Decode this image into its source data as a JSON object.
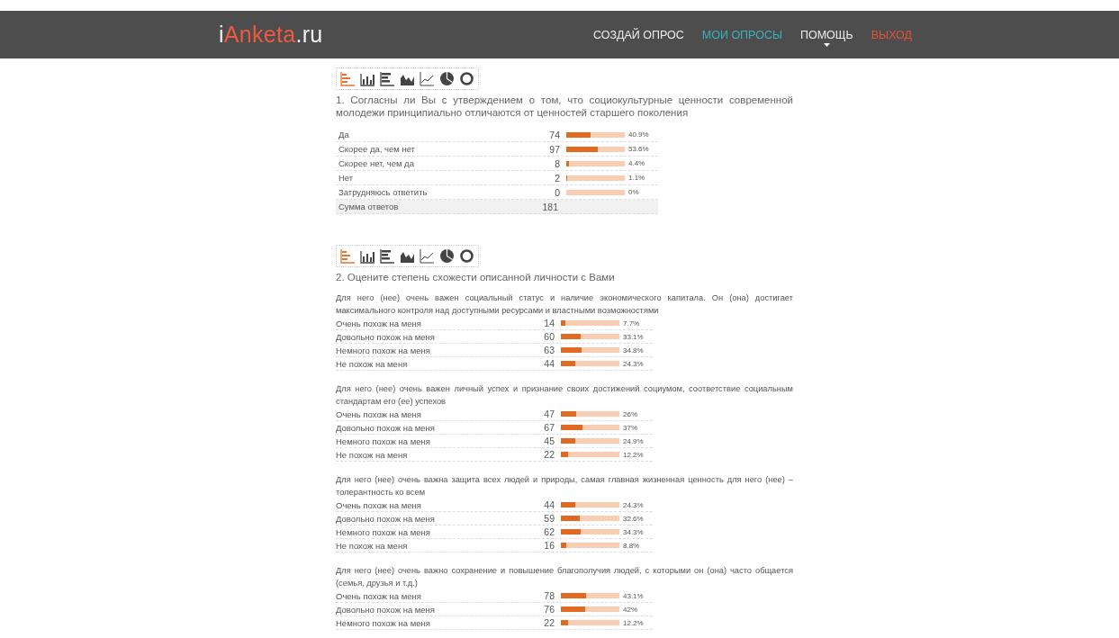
{
  "header": {
    "logo": [
      {
        "text": "i",
        "accent": false
      },
      {
        "text": "Anketa",
        "accent": true
      },
      {
        "text": ".ru",
        "accent": false
      }
    ],
    "nav": [
      {
        "label": "СОЗДАЙ ОПРОС",
        "kind": "link",
        "selected": false,
        "has_menu": false
      },
      {
        "label": "МОИ ОПРОСЫ",
        "kind": "link",
        "selected": true,
        "has_menu": false
      },
      {
        "label": "ПОМОЩЬ",
        "kind": "link",
        "selected": false,
        "has_menu": true
      },
      {
        "label": "ВЫХОД",
        "kind": "logout",
        "selected": false,
        "has_menu": false
      }
    ]
  },
  "questions": [
    {
      "chart_types": [
        {
          "kind": "hbar",
          "selected": true
        },
        {
          "kind": "vbar",
          "selected": false
        },
        {
          "kind": "hbar2",
          "selected": false
        },
        {
          "kind": "area",
          "selected": false
        },
        {
          "kind": "line",
          "selected": false
        },
        {
          "kind": "pie",
          "selected": false
        },
        {
          "kind": "donut",
          "selected": false
        }
      ],
      "title": "1. Согласны ли Вы с утверждением о том, что социокультурные ценности современной молодежи принципиально отличаются от ценностей старшего поколения",
      "tables": [
        {
          "rows": [
            {
              "label": "Да",
              "count": "74",
              "level": 0.409,
              "percent": "40.9%"
            },
            {
              "label": "Скорее да, чем нет",
              "count": "97",
              "level": 0.536,
              "percent": "53.6%"
            },
            {
              "label": "Скорее нет, чем да",
              "count": "8",
              "level": 0.044,
              "percent": "4.4%"
            },
            {
              "label": "Нет",
              "count": "2",
              "level": 0.011,
              "percent": "1.1%"
            },
            {
              "label": "Затрудняюсь ответить",
              "count": "0",
              "percent": "0%"
            }
          ],
          "total": {
            "label": "Сумма ответов",
            "count": "181"
          }
        }
      ]
    },
    {
      "chart_types": [
        {
          "kind": "hbar",
          "selected": true
        },
        {
          "kind": "vbar",
          "selected": false
        },
        {
          "kind": "hbar2",
          "selected": false
        },
        {
          "kind": "area",
          "selected": false
        },
        {
          "kind": "line",
          "selected": false
        },
        {
          "kind": "pie",
          "selected": false
        },
        {
          "kind": "donut",
          "selected": false
        }
      ],
      "title": "2. Оцените степень схожести описанной личности с Вами",
      "tables": [
        {
          "description": "Для него (нее) очень важен социальный статус и наличие экономического капитала. Он (она) достигает максимального контроля над доступными ресурсами и властными возможностями",
          "rows": [
            {
              "label": "Очень похож на меня",
              "count": "14",
              "level": 0.077,
              "percent": "7.7%"
            },
            {
              "label": "Довольно похож на меня",
              "count": "60",
              "level": 0.331,
              "percent": "33.1%"
            },
            {
              "label": "Немного похож на меня",
              "count": "63",
              "level": 0.348,
              "percent": "34.8%"
            },
            {
              "label": "Не похож на меня",
              "count": "44",
              "level": 0.243,
              "percent": "24.3%"
            }
          ]
        },
        {
          "description": "Для него (нее) очень важен личный успех и признание своих достижений социумом, соответствие социальным стандартам его (ее) успехов",
          "rows": [
            {
              "label": "Очень похож на меня",
              "count": "47",
              "level": 0.26,
              "percent": "26%"
            },
            {
              "label": "Довольно похож на меня",
              "count": "67",
              "level": 0.37,
              "percent": "37%"
            },
            {
              "label": "Немного похож на меня",
              "count": "45",
              "level": 0.249,
              "percent": "24.9%"
            },
            {
              "label": "Не похож на меня",
              "count": "22",
              "level": 0.122,
              "percent": "12.2%"
            }
          ]
        },
        {
          "description": "Для него (нее) очень важна защита всех людей и природы, самая главная жизненная ценность для него (нее) – толерантность ко всем",
          "rows": [
            {
              "label": "Очень похож на меня",
              "count": "44",
              "level": 0.243,
              "percent": "24.3%"
            },
            {
              "label": "Довольно похож на меня",
              "count": "59",
              "level": 0.326,
              "percent": "32.6%"
            },
            {
              "label": "Немного похож на меня",
              "count": "62",
              "level": 0.343,
              "percent": "34.3%"
            },
            {
              "label": "Не похож на меня",
              "count": "16",
              "level": 0.088,
              "percent": "8.8%"
            }
          ]
        },
        {
          "description": "Для него (нее) очень важно сохранение и повышение благополучия людей, с которыми он (она) часто общается (семья, друзья и т.д.)",
          "rows": [
            {
              "label": "Очень похож на меня",
              "count": "78",
              "level": 0.431,
              "percent": "43.1%"
            },
            {
              "label": "Довольно похож на меня",
              "count": "76",
              "level": 0.42,
              "percent": "42%"
            },
            {
              "label": "Немного похож на меня",
              "count": "22",
              "level": 0.122,
              "percent": "12.2%"
            }
          ]
        }
      ]
    }
  ]
}
